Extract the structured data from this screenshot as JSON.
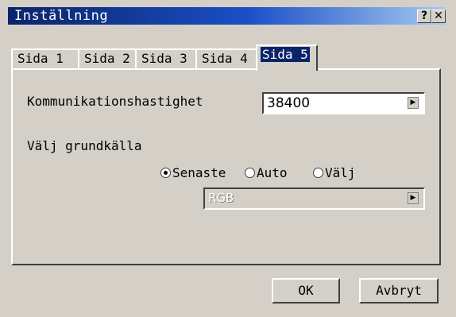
{
  "window": {
    "title": "Inställning",
    "help_label": "?",
    "close_label": "✕"
  },
  "tabs": [
    {
      "label": "Sida 1"
    },
    {
      "label": "Sida 2"
    },
    {
      "label": "Sida 3"
    },
    {
      "label": "Sida 4"
    },
    {
      "label": "Sida 5",
      "active": true
    }
  ],
  "panel": {
    "baud_label": "Kommunikationshastighet",
    "baud_value": "38400",
    "source_label": "Välj grundkälla",
    "source_options": [
      {
        "label": "Senaste",
        "checked": true
      },
      {
        "label": "Auto",
        "checked": false
      },
      {
        "label": "Välj",
        "checked": false
      }
    ],
    "source_value": "RGB",
    "dropdown_arrow": "▶"
  },
  "buttons": {
    "ok": "OK",
    "cancel": "Avbryt"
  },
  "colors": {
    "titlebar_start": "#0a246a",
    "titlebar_end": "#a6caf0",
    "face": "#d4d0c8"
  }
}
